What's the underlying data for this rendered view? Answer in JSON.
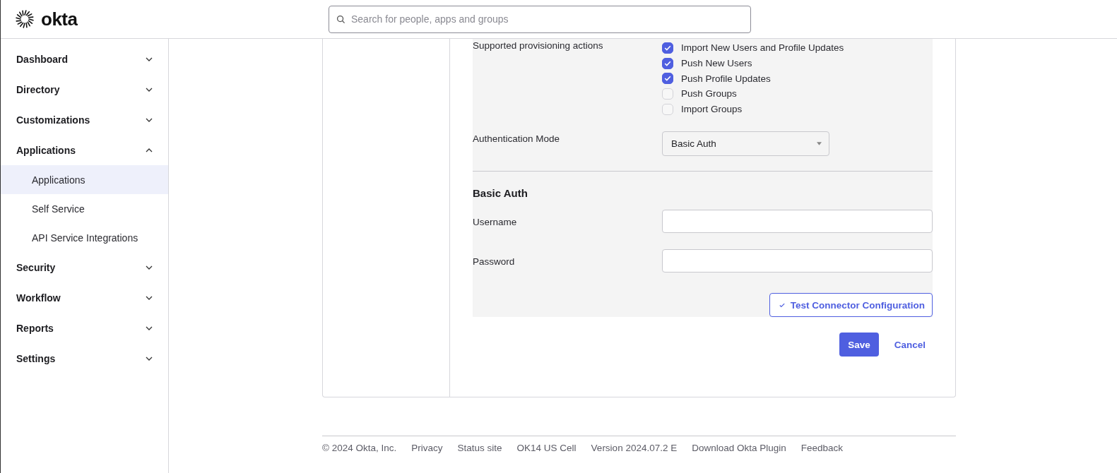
{
  "header": {
    "logo": "okta",
    "search": {
      "placeholder": "Search for people, apps and groups"
    }
  },
  "sidebar": {
    "items": [
      {
        "label": "Dashboard",
        "expanded": false
      },
      {
        "label": "Directory",
        "expanded": false
      },
      {
        "label": "Customizations",
        "expanded": false
      },
      {
        "label": "Applications",
        "expanded": true,
        "children": [
          {
            "label": "Applications",
            "selected": true
          },
          {
            "label": "Self Service",
            "selected": false
          },
          {
            "label": "API Service Integrations",
            "selected": false
          }
        ]
      },
      {
        "label": "Security",
        "expanded": false
      },
      {
        "label": "Workflow",
        "expanded": false
      },
      {
        "label": "Reports",
        "expanded": false
      },
      {
        "label": "Settings",
        "expanded": false
      }
    ]
  },
  "form": {
    "provisioning": {
      "label": "Supported provisioning actions",
      "options": [
        {
          "label": "Import New Users and Profile Updates",
          "checked": true
        },
        {
          "label": "Push New Users",
          "checked": true
        },
        {
          "label": "Push Profile Updates",
          "checked": true
        },
        {
          "label": "Push Groups",
          "checked": false
        },
        {
          "label": "Import Groups",
          "checked": false
        }
      ]
    },
    "auth_mode": {
      "label": "Authentication Mode",
      "value": "Basic Auth"
    },
    "section_title": "Basic Auth",
    "fields": [
      {
        "label": "Username"
      },
      {
        "label": "Password"
      }
    ],
    "test_button": "Test Connector Configuration",
    "save": "Save",
    "cancel": "Cancel"
  },
  "footer": {
    "links": [
      "© 2024 Okta, Inc.",
      "Privacy",
      "Status site",
      "OK14 US Cell",
      "Version 2024.07.2 E",
      "Download Okta Plugin",
      "Feedback"
    ]
  }
}
